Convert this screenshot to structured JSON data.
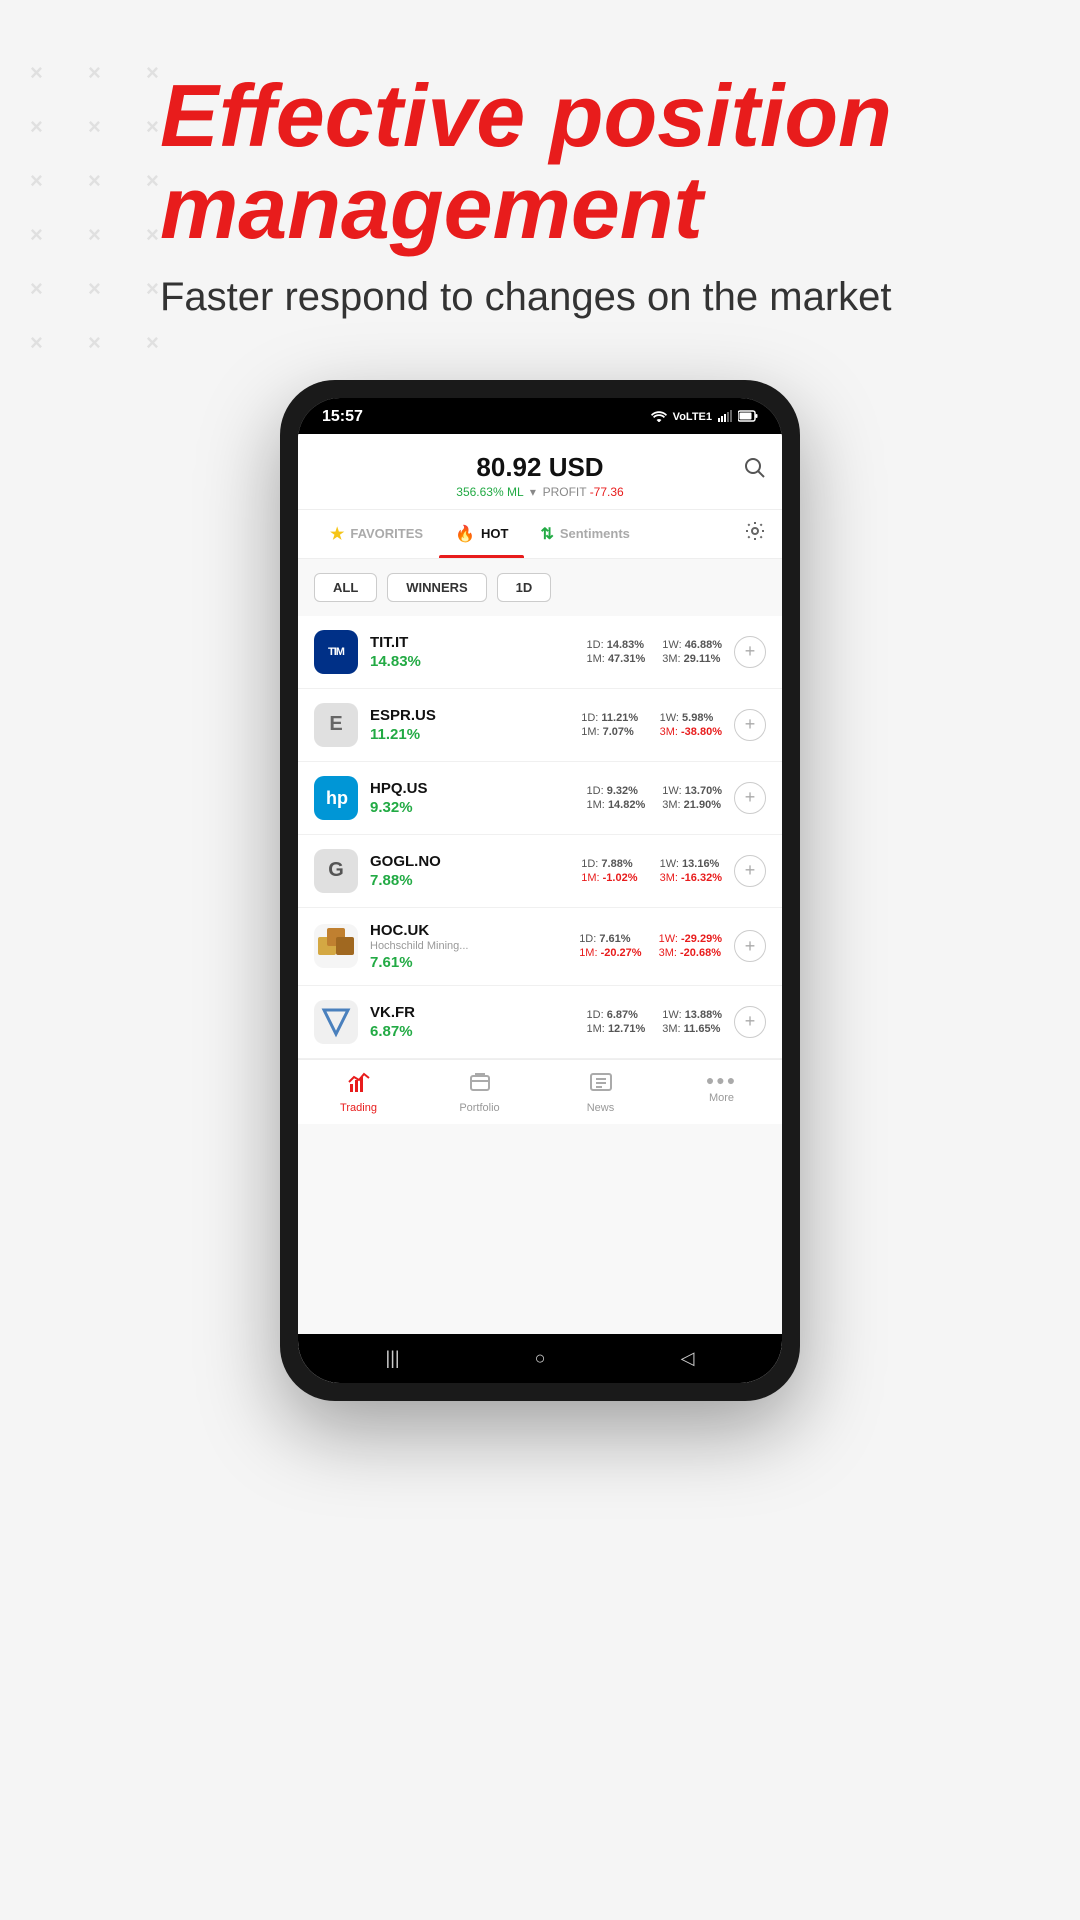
{
  "background": {
    "color": "#f5f5f5"
  },
  "decorative_dots": {
    "symbol": "×",
    "rows": 6,
    "cols": 3
  },
  "header": {
    "headline": "Effective position management",
    "subheadline": "Faster respond to changes on the market"
  },
  "status_bar": {
    "time": "15:57",
    "wifi": "WiFi",
    "lte": "VoLTE 1",
    "battery": "Battery"
  },
  "balance": {
    "amount": "80.92 USD",
    "ml_percent": "356.63% ML",
    "profit_label": "PROFIT",
    "profit_value": "-77.36"
  },
  "tabs": [
    {
      "id": "favorites",
      "label": "FAVORITES",
      "icon": "★",
      "active": false
    },
    {
      "id": "hot",
      "label": "HOT",
      "icon": "🔥",
      "active": true
    },
    {
      "id": "sentiments",
      "label": "Sentiments",
      "icon": "↕",
      "active": false
    }
  ],
  "filters": [
    {
      "id": "all",
      "label": "ALL"
    },
    {
      "id": "winners",
      "label": "WINNERS"
    },
    {
      "id": "1d",
      "label": "1D"
    }
  ],
  "stocks": [
    {
      "ticker": "TIT.IT",
      "logo_type": "tim",
      "logo_text": "TIM",
      "subtitle": "",
      "change": "14.83%",
      "stats": [
        {
          "label": "1D:",
          "value": "14.83%",
          "neg": false
        },
        {
          "label": "1W:",
          "value": "46.88%",
          "neg": false
        },
        {
          "label": "1M:",
          "value": "47.31%",
          "neg": false
        },
        {
          "label": "3M:",
          "value": "29.11%",
          "neg": false
        }
      ]
    },
    {
      "ticker": "ESPR.US",
      "logo_type": "espr",
      "logo_text": "E",
      "subtitle": "",
      "change": "11.21%",
      "stats": [
        {
          "label": "1D:",
          "value": "11.21%",
          "neg": false
        },
        {
          "label": "1W:",
          "value": "5.98%",
          "neg": false
        },
        {
          "label": "1M:",
          "value": "7.07%",
          "neg": false
        },
        {
          "label": "3M:",
          "value": "-38.80%",
          "neg": true
        }
      ]
    },
    {
      "ticker": "HPQ.US",
      "logo_type": "hpq",
      "logo_text": "HP",
      "subtitle": "",
      "change": "9.32%",
      "stats": [
        {
          "label": "1D:",
          "value": "9.32%",
          "neg": false
        },
        {
          "label": "1W:",
          "value": "13.70%",
          "neg": false
        },
        {
          "label": "1M:",
          "value": "14.82%",
          "neg": false
        },
        {
          "label": "3M:",
          "value": "21.90%",
          "neg": false
        }
      ]
    },
    {
      "ticker": "GOGL.NO",
      "logo_type": "gogl",
      "logo_text": "G",
      "subtitle": "",
      "change": "7.88%",
      "stats": [
        {
          "label": "1D:",
          "value": "7.88%",
          "neg": false
        },
        {
          "label": "1W:",
          "value": "13.16%",
          "neg": false
        },
        {
          "label": "1M:",
          "value": "-1.02%",
          "neg": true
        },
        {
          "label": "3M:",
          "value": "-16.32%",
          "neg": true
        }
      ]
    },
    {
      "ticker": "HOC.UK",
      "logo_type": "hoc",
      "logo_text": "⛏",
      "subtitle": "Hochschild Mining...",
      "change": "7.61%",
      "stats": [
        {
          "label": "1D:",
          "value": "7.61%",
          "neg": false
        },
        {
          "label": "1W:",
          "value": "-29.29%",
          "neg": true
        },
        {
          "label": "1M:",
          "value": "-20.27%",
          "neg": true
        },
        {
          "label": "3M:",
          "value": "-20.68%",
          "neg": true
        }
      ]
    },
    {
      "ticker": "VK.FR",
      "logo_type": "vk",
      "logo_text": "V",
      "subtitle": "",
      "change": "6.87%",
      "stats": [
        {
          "label": "1D:",
          "value": "6.87%",
          "neg": false
        },
        {
          "label": "1W:",
          "value": "13.88%",
          "neg": false
        },
        {
          "label": "1M:",
          "value": "12.71%",
          "neg": false
        },
        {
          "label": "3M:",
          "value": "11.65%",
          "neg": false
        }
      ]
    }
  ],
  "bottom_nav": [
    {
      "id": "trading",
      "label": "Trading",
      "icon": "📊",
      "active": true
    },
    {
      "id": "portfolio",
      "label": "Portfolio",
      "icon": "📁",
      "active": false
    },
    {
      "id": "news",
      "label": "News",
      "icon": "📰",
      "active": false
    },
    {
      "id": "more",
      "label": "More",
      "icon": "···",
      "active": false
    }
  ],
  "android_nav": {
    "back": "◁",
    "home": "○",
    "menu": "|||"
  }
}
